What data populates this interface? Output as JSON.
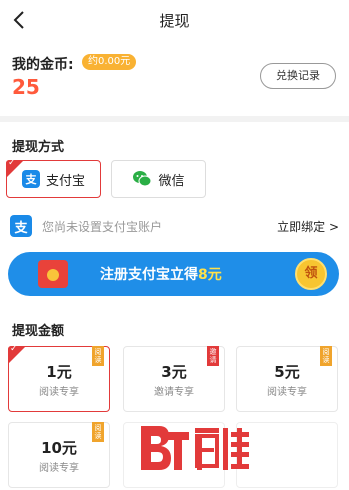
{
  "header": {
    "title": "提现",
    "back_icon": "chevron-left-icon"
  },
  "coins": {
    "label": "我的金币:",
    "approx": "约0.00元",
    "amount": "25",
    "record_button": "兑换记录"
  },
  "method": {
    "title": "提现方式",
    "options": [
      {
        "label": "支付宝",
        "icon": "alipay-icon",
        "selected": true
      },
      {
        "label": "微信",
        "icon": "wechat-icon",
        "selected": false
      }
    ],
    "notice": "您尚未设置支付宝账户",
    "bind_link": "立即绑定 >",
    "banner_prefix": "注册支付宝立得",
    "banner_accent": "8元",
    "banner_coin": "领"
  },
  "amount": {
    "title": "提现金额",
    "tiles": [
      {
        "value": "1元",
        "sub": "阅读专享",
        "ribbon": "阅读",
        "ribbon_color": "gold",
        "selected": true
      },
      {
        "value": "3元",
        "sub": "邀请专享",
        "ribbon": "邀请",
        "ribbon_color": "red",
        "selected": false
      },
      {
        "value": "5元",
        "sub": "阅读专享",
        "ribbon": "阅读",
        "ribbon_color": "gold",
        "selected": false
      },
      {
        "value": "10元",
        "sub": "阅读专享",
        "ribbon": "阅读",
        "ribbon_color": "gold",
        "selected": false
      }
    ]
  },
  "colors": {
    "accent": "#e23a3a",
    "coin_orange": "#ff5a3c",
    "alipay_blue": "#1a8ae8",
    "badge_gold": "#f9b233"
  }
}
